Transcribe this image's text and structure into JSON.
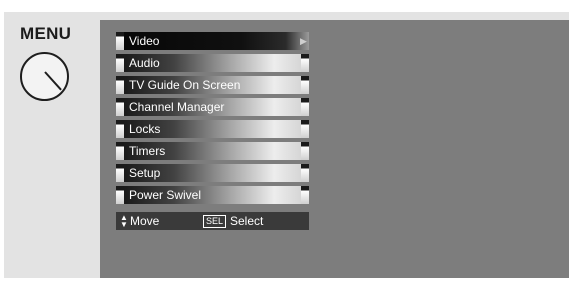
{
  "menu": {
    "title": "MENU",
    "items": [
      {
        "label": "Video",
        "selected": true
      },
      {
        "label": "Audio",
        "selected": false
      },
      {
        "label": "TV Guide On Screen",
        "selected": false
      },
      {
        "label": "Channel Manager",
        "selected": false
      },
      {
        "label": "Locks",
        "selected": false
      },
      {
        "label": "Timers",
        "selected": false
      },
      {
        "label": "Setup",
        "selected": false
      },
      {
        "label": "Power Swivel",
        "selected": false
      }
    ]
  },
  "footer": {
    "move_label": "Move",
    "sel_key": "SEL",
    "select_label": "Select"
  },
  "icons": {
    "knob": "dial-knob-icon",
    "submenu_arrow": "arrow-right-icon",
    "navigate": "up-down-arrows-icon"
  },
  "colors": {
    "screen_bg": "#7d7d7d",
    "panel_bg": "#e3e3e3",
    "selected_bar": "#070707",
    "footer_bg": "#3a3a3a"
  }
}
